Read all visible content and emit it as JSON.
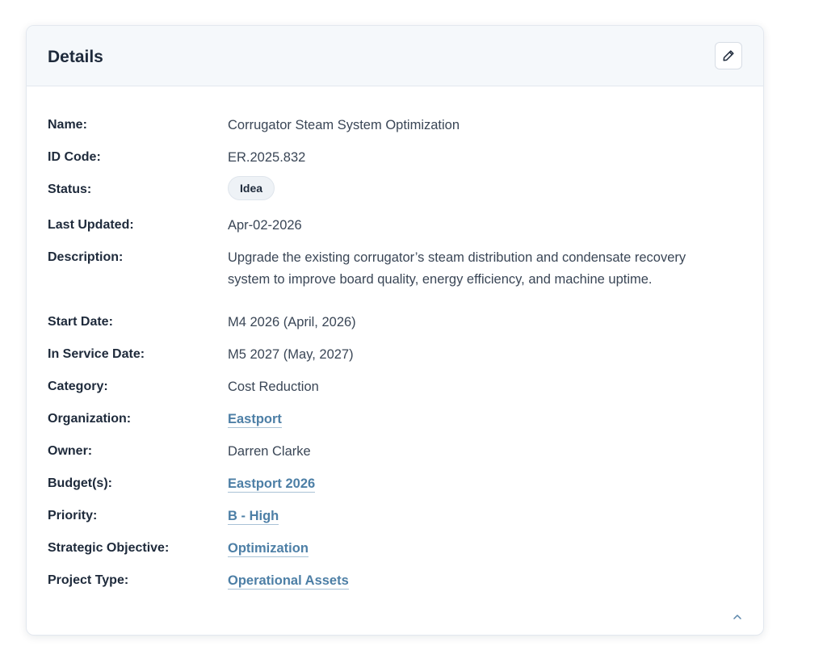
{
  "card": {
    "title": "Details",
    "edit_icon": "pencil-icon",
    "collapse_icon": "chevron-up-icon"
  },
  "fields": {
    "name": {
      "label": "Name:",
      "value": "Corrugator Steam System Optimization"
    },
    "id_code": {
      "label": "ID Code:",
      "value": "ER.2025.832"
    },
    "status": {
      "label": "Status:",
      "value": "Idea"
    },
    "last_updated": {
      "label": "Last Updated:",
      "value": "Apr-02-2026"
    },
    "description": {
      "label": "Description:",
      "value": "Upgrade the existing corrugator’s steam distribution and condensate recovery system to improve board quality, energy efficiency, and machine uptime."
    },
    "start_date": {
      "label": "Start Date:",
      "value": "M4 2026 (April, 2026)"
    },
    "in_service_date": {
      "label": "In Service Date:",
      "value": "M5 2027 (May, 2027)"
    },
    "category": {
      "label": "Category:",
      "value": "Cost Reduction"
    },
    "organization": {
      "label": "Organization:",
      "value": "Eastport"
    },
    "owner": {
      "label": "Owner:",
      "value": "Darren Clarke"
    },
    "budgets": {
      "label": "Budget(s):",
      "value": "Eastport 2026"
    },
    "priority": {
      "label": "Priority:",
      "value": "B - High"
    },
    "strategic_objective": {
      "label": "Strategic Objective:",
      "value": "Optimization"
    },
    "project_type": {
      "label": "Project Type:",
      "value": "Operational Assets"
    }
  },
  "colors": {
    "link": "#4d7fa6",
    "label": "#1e2a3b",
    "value": "#3a4656",
    "header_bg": "#f5f8fb",
    "badge_bg": "#eef2f6"
  }
}
